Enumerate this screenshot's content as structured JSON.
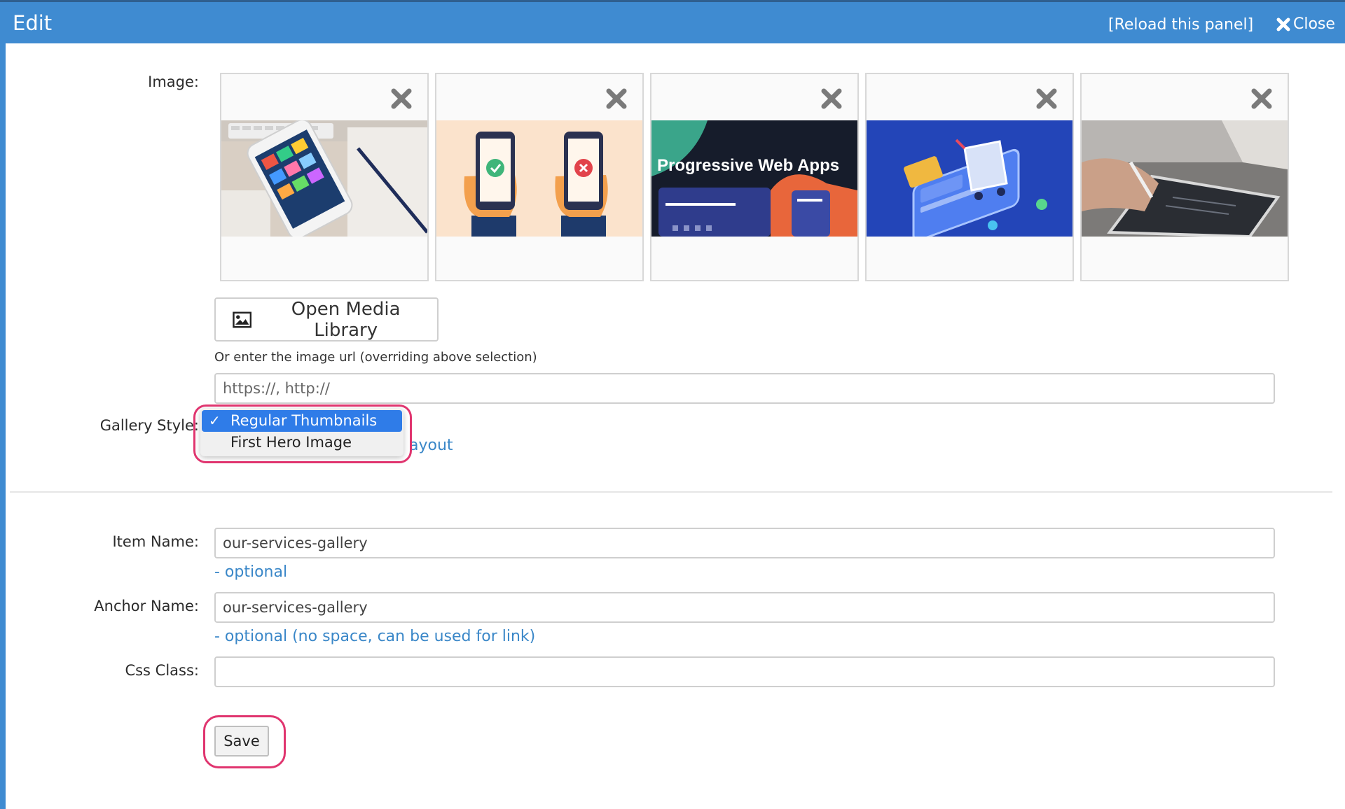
{
  "window": {
    "title": "Edit",
    "reload_label": "[Reload this panel]",
    "close_label": "Close"
  },
  "image_field": {
    "label": "Image:",
    "thumbnails": [
      {
        "name": "thumb-phone-desk",
        "overlay_text": ""
      },
      {
        "name": "thumb-phones-check-cross",
        "overlay_text": ""
      },
      {
        "name": "thumb-progressive-web-apps",
        "overlay_text": "Progressive Web Apps"
      },
      {
        "name": "thumb-shopping-cart-phone",
        "overlay_text": ""
      },
      {
        "name": "thumb-tablet-stylus",
        "overlay_text": ""
      }
    ],
    "remove_icon": "close-x-icon",
    "open_media_library_label": "Open Media Library",
    "url_hint": "Or enter the image url (overriding above selection)",
    "url_placeholder": "https://, http://"
  },
  "gallery_style": {
    "label": "Gallery Style:",
    "options": [
      "Regular Thumbnails",
      "First Hero Image"
    ],
    "selected": "Regular Thumbnails",
    "layout_link_text": "ayout"
  },
  "item_name": {
    "label": "Item Name:",
    "value": "our-services-gallery",
    "helper": "- optional"
  },
  "anchor_name": {
    "label": "Anchor Name:",
    "value": "our-services-gallery",
    "helper": "- optional (no space, can be used for link)"
  },
  "css_class": {
    "label": "Css Class:",
    "value": ""
  },
  "save_label": "Save",
  "colors": {
    "titlebar": "#3f8bd1",
    "link": "#3a87c8",
    "highlight": "#e0356f",
    "selected_option": "#2f7ce8"
  }
}
